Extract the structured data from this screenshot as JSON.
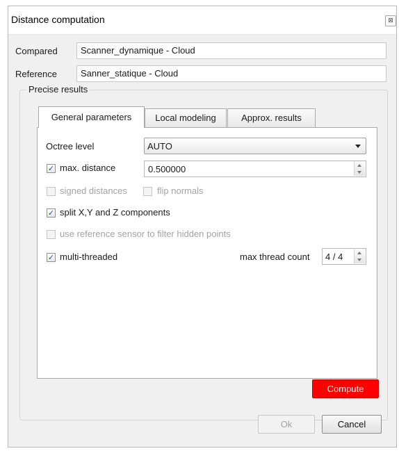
{
  "window": {
    "title": "Distance computation",
    "close_glyph": "⊠"
  },
  "compared": {
    "label": "Compared",
    "value": "Scanner_dynamique - Cloud"
  },
  "reference": {
    "label": "Reference",
    "value": "Sanner_statique - Cloud"
  },
  "group": {
    "title": "Precise results"
  },
  "tabs": [
    {
      "label": "General parameters",
      "active": true
    },
    {
      "label": "Local modeling",
      "active": false
    },
    {
      "label": "Approx. results",
      "active": false
    }
  ],
  "general": {
    "octree_label": "Octree level",
    "octree_value": "AUTO",
    "max_distance": {
      "label": "max. distance",
      "checked": true,
      "value": "0.500000"
    },
    "signed_distances": {
      "label": "signed distances",
      "checked": false,
      "enabled": false
    },
    "flip_normals": {
      "label": "flip normals",
      "checked": false,
      "enabled": false
    },
    "split_components": {
      "label": "split X,Y and Z components",
      "checked": true
    },
    "use_sensor": {
      "label": "use reference sensor to filter hidden points",
      "checked": false,
      "enabled": false
    },
    "multi_threaded": {
      "label": "multi-threaded",
      "checked": true
    },
    "max_thread_label": "max thread count",
    "max_thread_value": "4 / 4"
  },
  "buttons": {
    "compute": "Compute",
    "ok": "Ok",
    "cancel": "Cancel"
  },
  "colors": {
    "compute_bg": "#ff0000",
    "checkmark": "#2b4f9a"
  }
}
